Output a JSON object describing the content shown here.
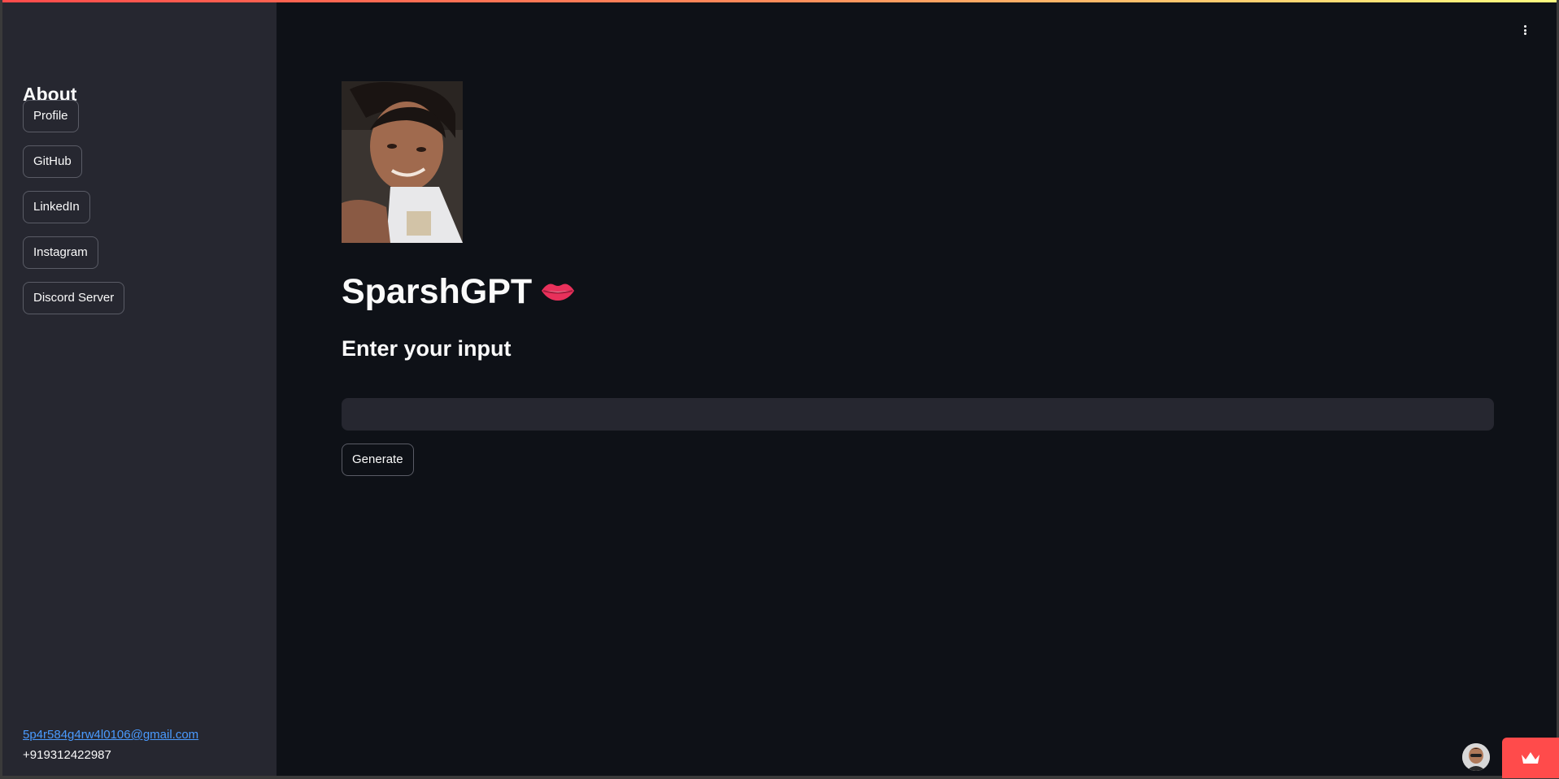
{
  "sidebar": {
    "title": "About",
    "buttons": [
      {
        "label": "Profile"
      },
      {
        "label": "GitHub"
      },
      {
        "label": "LinkedIn"
      },
      {
        "label": "Instagram"
      },
      {
        "label": "Discord Server"
      }
    ],
    "email": "5p4r584g4rw4l0106@gmail.com",
    "phone": "+919312422987"
  },
  "main": {
    "title": "SparshGPT",
    "title_emoji": "lips",
    "subtitle": "Enter your input",
    "input": {
      "value": "",
      "placeholder": ""
    },
    "generate_label": "Generate"
  },
  "icons": {
    "menu": "kebab-menu-icon",
    "badge": "crown-icon"
  },
  "colors": {
    "background": "#0e1117",
    "sidebar": "#262730",
    "accent": "#ff4b4b",
    "link": "#4a9bff"
  }
}
